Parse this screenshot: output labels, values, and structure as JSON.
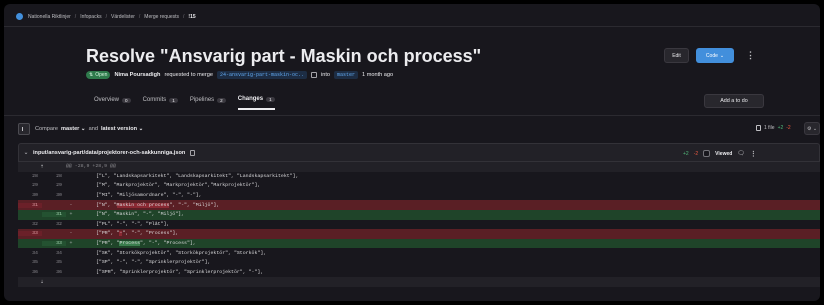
{
  "breadcrumb": [
    "Nationella Riktlinjer",
    "Infopacks",
    "Värdelister",
    "Merge requests",
    "!15"
  ],
  "mr": {
    "title": "Resolve \"Ansvarig part - Maskin och process\"",
    "status": "Open",
    "author": "Nima Poursadigh",
    "requested_text": "requested to merge",
    "source_branch": "24-ansvarig-part-maskin-oc..",
    "into_text": "into",
    "target_branch": "master",
    "time_ago": "1 month ago"
  },
  "actions": {
    "edit": "Edit",
    "code": "Code",
    "todo": "Add a to do"
  },
  "tabs": [
    {
      "label": "Overview",
      "count": "0"
    },
    {
      "label": "Commits",
      "count": "1"
    },
    {
      "label": "Pipelines",
      "count": "2"
    },
    {
      "label": "Changes",
      "count": "1"
    }
  ],
  "compare": {
    "label": "Compare",
    "base": "master",
    "and": "and",
    "version": "latest version",
    "files": "1 file",
    "added": "+2",
    "removed": "-2"
  },
  "file": {
    "path": "input/ansvarig-part/data/projektorer-och-sakkunniga.json",
    "added": "+2",
    "removed": "-2",
    "viewed_label": "Viewed"
  },
  "diff": {
    "hunk_header": "@@ -28,9 +28,9 @@",
    "lines": [
      {
        "type": "ctx",
        "old": "28",
        "new": "28",
        "marker": "",
        "pre": "[\"L\", \"Landskapsarkitekt\", \"Landskapsarkitekt\", \"Landskapsarkitekt\"],",
        "hl": "",
        "post": ""
      },
      {
        "type": "ctx",
        "old": "29",
        "new": "29",
        "marker": "",
        "pre": "[\"M\", \"Markprojektör\", \"Markprojektör\",\"Markprojektör\"],",
        "hl": "",
        "post": ""
      },
      {
        "type": "ctx",
        "old": "30",
        "new": "30",
        "marker": "",
        "pre": "[\"MI\", \"Miljösamordnare\", \"-\", \"-\"],",
        "hl": "",
        "post": ""
      },
      {
        "type": "del",
        "old": "31",
        "new": "",
        "marker": "-",
        "pre": "[\"N\", \"",
        "hl": "Maskin och process",
        "post": "\", \"-\", \"Miljö\"],"
      },
      {
        "type": "add",
        "old": "",
        "new": "31",
        "marker": "+",
        "pre": "[\"N\", \"Maskin\", \"-\", \"Miljö\"],",
        "hl": "",
        "post": ""
      },
      {
        "type": "ctx",
        "old": "32",
        "new": "32",
        "marker": "",
        "pre": "[\"PL\", \"-\", \"-\", \"Plåt\"],",
        "hl": "",
        "post": ""
      },
      {
        "type": "del",
        "old": "33",
        "new": "",
        "marker": "-",
        "pre": "[\"PR\", \"",
        "hl": "-",
        "post": "\", \"-\", \"Process\"],"
      },
      {
        "type": "add",
        "old": "",
        "new": "33",
        "marker": "+",
        "pre": "[\"PR\", \"",
        "hl": "Process",
        "post": "\", \"-\", \"Process\"],"
      },
      {
        "type": "ctx",
        "old": "34",
        "new": "34",
        "marker": "",
        "pre": "[\"SK\", \"Storkökprojektör\", \"Storkökprojektör\", \"Storkök\"],",
        "hl": "",
        "post": ""
      },
      {
        "type": "ctx",
        "old": "35",
        "new": "35",
        "marker": "",
        "pre": "[\"SP\", \"-\", \"-\", \"Sprinklerprojektör\"],",
        "hl": "",
        "post": ""
      },
      {
        "type": "ctx",
        "old": "36",
        "new": "36",
        "marker": "",
        "pre": "[\"SPR\", \"Sprinklerprojektör\", \"Sprinklerprojektör\", \"-\"],",
        "hl": "",
        "post": ""
      }
    ]
  },
  "colors": {
    "background": "#18171d",
    "accent": "#428fdc",
    "added": "#52b87a",
    "removed": "#ec5941",
    "add_row": "#1f4429",
    "del_row": "#5a1f25"
  },
  "icons": {
    "logo": "gitlab-logo-icon",
    "copy": "copy-icon",
    "sidebar_toggle": "file-tree-icon",
    "file": "file-icon",
    "settings": "gear-icon",
    "comment": "comment-icon",
    "expand": "expand-up-icon"
  }
}
